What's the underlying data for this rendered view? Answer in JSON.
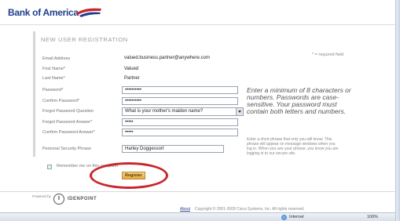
{
  "brand": {
    "name": "Bank of America"
  },
  "form": {
    "title": "NEW USER REGISTRATION",
    "required_note": "* = required field",
    "fields": {
      "email": {
        "label": "Email Address",
        "value": "valued.business.partner@anywhere.com"
      },
      "first_name": {
        "label": "First Name*",
        "value": "Valued"
      },
      "last_name": {
        "label": "Last Name*",
        "value": "Partner"
      },
      "password": {
        "label": "Password*",
        "value": "••••••••••"
      },
      "confirm_password": {
        "label": "Confirm Password*",
        "value": "••••••••••"
      },
      "question": {
        "label": "Forgot Password Question",
        "value": "What is your mother's maiden name?"
      },
      "answer": {
        "label": "Forgot Password Answer*",
        "value": "•••••"
      },
      "confirm_answer": {
        "label": "Confirm Password Answer*",
        "value": "•••••"
      },
      "phrase": {
        "label": "Personal Security Phrase",
        "value": "Harley Doggessort"
      }
    },
    "password_hint": "Enter a minimum of 8 characters or numbers. Passwords are case-sensitive. Your password must contain both letters and numbers.",
    "phrase_hint": "Enter a short phrase that only you will know. This phrase will appear on message windows when you log in. When you see your phrase, you know you are logging in to our secure site.",
    "remember_label": "Remember me on this computer",
    "register_label": "Register"
  },
  "footer": {
    "powered_by": "Powered by",
    "idp_mark": "I",
    "idp_name": "IDENPOINT",
    "about": "About",
    "copyright": "Copyright © 2001-2009 Cisco Systems, Inc. All rights reserved."
  },
  "statusbar": {
    "zone": "Internet",
    "zoom": "100%"
  },
  "colors": {
    "brand_blue": "#1f3f8c",
    "brand_red": "#c9262c",
    "register_button": "#e7a945"
  }
}
